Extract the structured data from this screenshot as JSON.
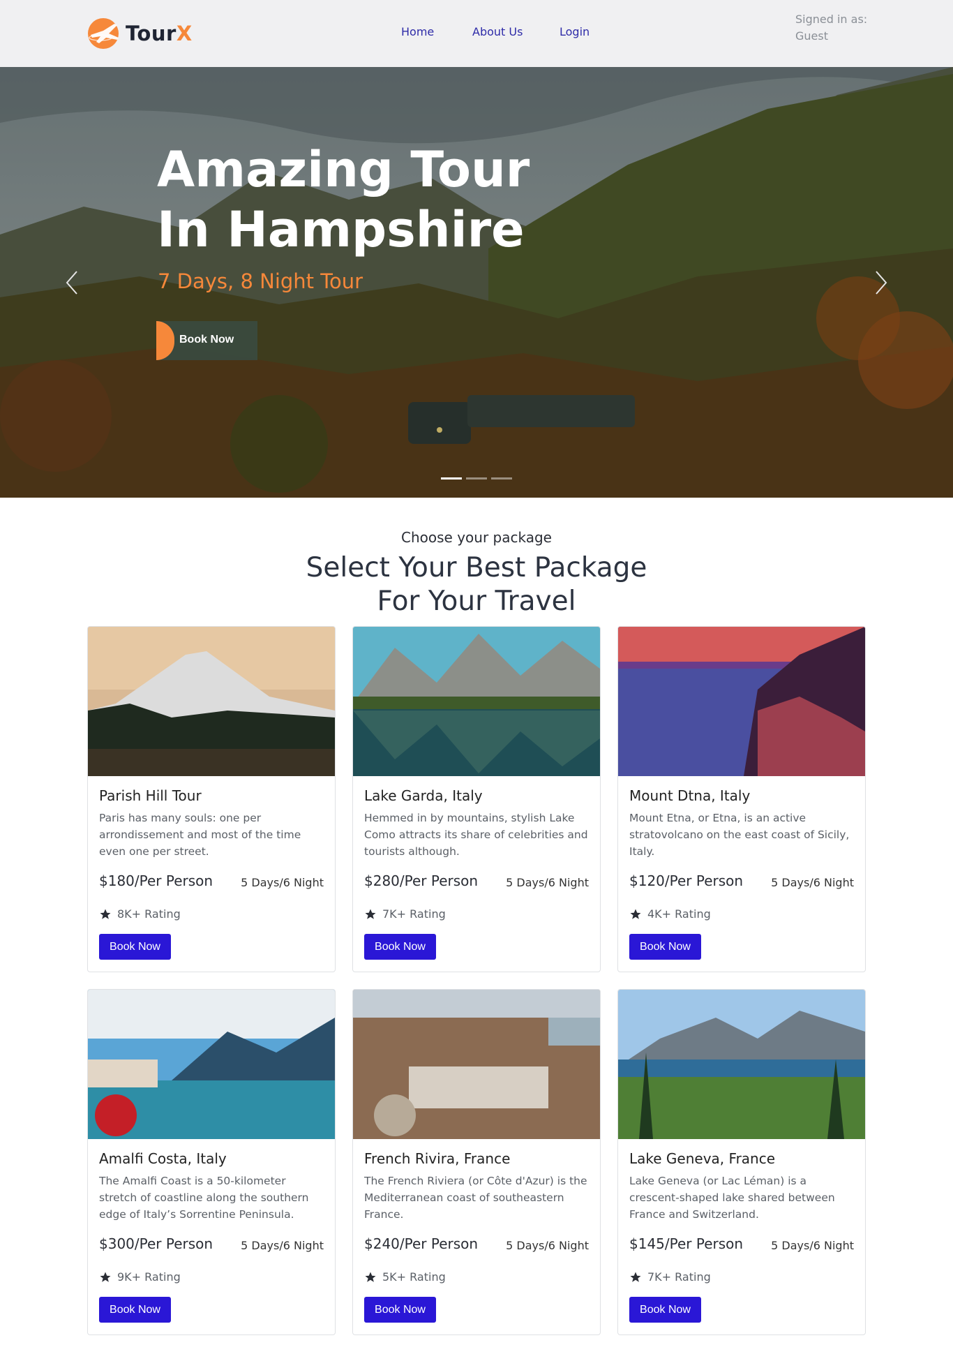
{
  "header": {
    "brand_main": "Tour",
    "brand_accent": "X",
    "nav": [
      {
        "label": "Home"
      },
      {
        "label": "About Us"
      },
      {
        "label": "Login"
      }
    ],
    "signed_in_label": "Signed in as:",
    "signed_in_user": "Guest"
  },
  "hero": {
    "title_line1": "Amazing Tour",
    "title_line2": "In Hampshire",
    "subtitle": "7 Days, 8 Night Tour",
    "cta": "Book Now",
    "prev_icon": "chevron-left-icon",
    "next_icon": "chevron-right-icon",
    "slides": 3,
    "active_slide": 1
  },
  "packages": {
    "eyebrow": "Choose your package",
    "heading_line1": "Select Your Best Package",
    "heading_line2": "For Your Travel",
    "items": [
      {
        "title": "Parish Hill Tour",
        "description": "Paris has many souls: one per arrondissement and most of the time even one per street.",
        "price": "$180/Per Person",
        "duration": "5 Days/6 Night",
        "rating": "8K+ Rating",
        "cta": "Book Now"
      },
      {
        "title": "Lake Garda, Italy",
        "description": "Hemmed in by mountains, stylish Lake Como attracts its share of celebrities and tourists although.",
        "price": "$280/Per Person",
        "duration": "5 Days/6 Night",
        "rating": "7K+ Rating",
        "cta": "Book Now"
      },
      {
        "title": "Mount Dtna, Italy",
        "description": "Mount Etna, or Etna, is an active stratovolcano on the east coast of Sicily, Italy.",
        "price": "$120/Per Person",
        "duration": "5 Days/6 Night",
        "rating": "4K+ Rating",
        "cta": "Book Now"
      },
      {
        "title": "Amalfi Costa, Italy",
        "description": "The Amalfi Coast is a 50-kilometer stretch of coastline along the southern edge of Italy’s Sorrentine Peninsula.",
        "price": "$300/Per Person",
        "duration": "5 Days/6 Night",
        "rating": "9K+ Rating",
        "cta": "Book Now"
      },
      {
        "title": "French Rivira, France",
        "description": "The French Riviera (or Côte d'Azur) is the Mediterranean coast of southeastern France.",
        "price": "$240/Per Person",
        "duration": "5 Days/6 Night",
        "rating": "5K+ Rating",
        "cta": "Book Now"
      },
      {
        "title": "Lake Geneva, France",
        "description": "Lake Geneva (or Lac Léman) is a crescent-shaped lake shared between France and Switzerland.",
        "price": "$145/Per Person",
        "duration": "5 Days/6 Night",
        "rating": "7K+ Rating",
        "cta": "Book Now"
      }
    ]
  },
  "colors": {
    "accent": "#f6883a",
    "primary_button": "#2a17d6",
    "nav_link": "#2e2ba8",
    "header_bg": "#f0f0f2"
  }
}
